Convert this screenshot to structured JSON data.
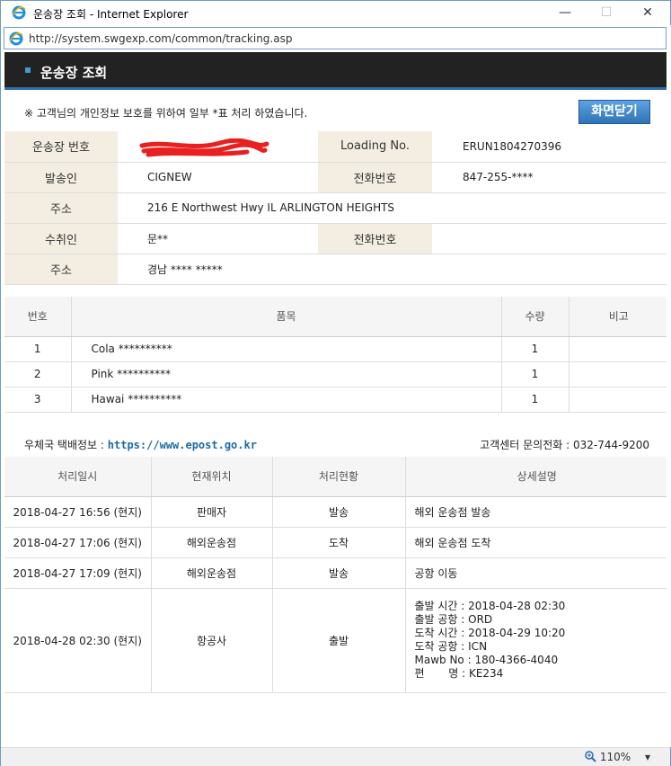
{
  "window": {
    "title": "운송장 조회 - Internet Explorer",
    "minimize": "—",
    "maximize": "☐",
    "close": "✕"
  },
  "address": {
    "url": "http://system.swgexp.com/common/tracking.asp"
  },
  "header": {
    "title": "운송장 조회"
  },
  "notice": "※ 고객님의 개인정보 보호를 위하여 일부 *표 처리 하였습니다.",
  "close_button": "화면닫기",
  "info": {
    "waybill_label": "운송장 번호",
    "loading_label": "Loading No.",
    "loading_value": "ERUN1804270396",
    "sender_label": "발송인",
    "sender_value": "CIGNEW",
    "sender_phone_label": "전화번호",
    "sender_phone_value": "847-255-****",
    "sender_addr_label": "주소",
    "sender_addr_value": "216 E Northwest Hwy IL ARLINGTON HEIGHTS",
    "receiver_label": "수취인",
    "receiver_value": "문**",
    "receiver_phone_label": "전화번호",
    "receiver_phone_value": "",
    "receiver_addr_label": "주소",
    "receiver_addr_value": "경남 **** *****"
  },
  "items": {
    "headers": [
      "번호",
      "품목",
      "수량",
      "비고"
    ],
    "rows": [
      {
        "no": "1",
        "name": "Cola **********",
        "qty": "1",
        "note": ""
      },
      {
        "no": "2",
        "name": "Pink **********",
        "qty": "1",
        "note": ""
      },
      {
        "no": "3",
        "name": "Hawai **********",
        "qty": "1",
        "note": ""
      }
    ]
  },
  "post": {
    "label": "우체국 택배정보 : ",
    "link": "https://www.epost.go.kr",
    "csc": "고객센터 문의전화 : 032-744-9200"
  },
  "tracking": {
    "headers": [
      "처리일시",
      "현재위치",
      "처리현황",
      "상세설명"
    ],
    "rows": [
      {
        "time": "2018-04-27 16:56 (현지)",
        "loc": "판매자",
        "status": "발송",
        "detail": "해외 운송점 발송"
      },
      {
        "time": "2018-04-27 17:06 (현지)",
        "loc": "해외운송점",
        "status": "도착",
        "detail": "해외 운송점 도착"
      },
      {
        "time": "2018-04-27 17:09 (현지)",
        "loc": "해외운송점",
        "status": "발송",
        "detail": "공항 이동"
      }
    ],
    "last": {
      "time": "2018-04-28 02:30 (현지)",
      "loc": "항공사",
      "status": "출발",
      "lines": [
        "출발 시간 : 2018-04-28 02:30",
        "출발 공항 : ORD",
        "도착 시간 : 2018-04-29 10:20",
        "도착 공항 : ICN",
        "Mawb No : 180-4366-4040",
        "편       명 : KE234"
      ]
    }
  },
  "status": {
    "zoom": "110%"
  },
  "icons": {
    "ie": "ie-logo-icon",
    "zoom": "zoom-icon"
  },
  "colors": {
    "header_bg": "#222222",
    "accent": "#2d6fae",
    "label_bg": "#f3eee1",
    "redaction": "#e8201f"
  }
}
